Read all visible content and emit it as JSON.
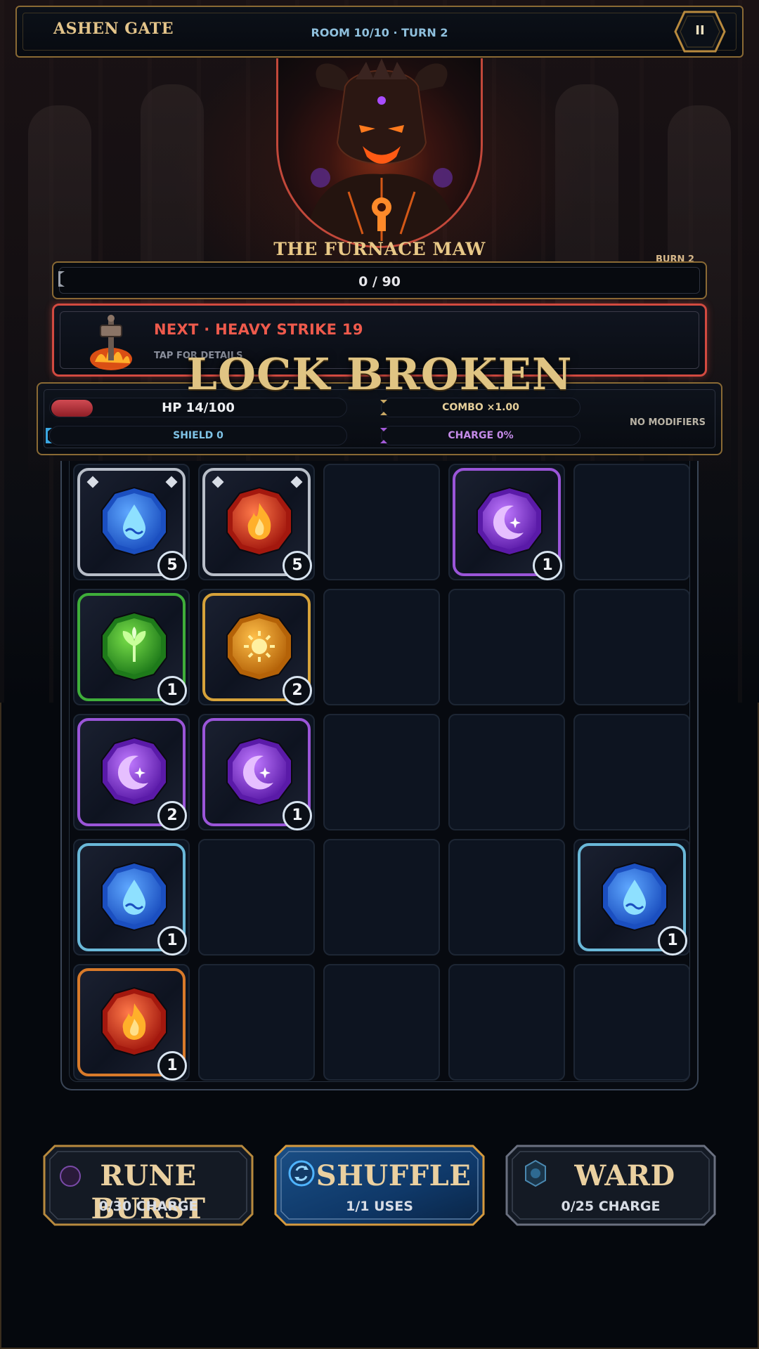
{
  "header": {
    "title": "ASHEN GATE",
    "room_info": "ROOM 10/10 · TURN 2",
    "pause_label": "II"
  },
  "boss": {
    "name": "THE FURNACE MAW",
    "burn_tag": "BURN 2",
    "hp_text": "0 / 90",
    "hp_fraction": 0.0
  },
  "intent": {
    "title": "NEXT · HEAVY STRIKE 19",
    "subtitle": "TAP FOR DETAILS",
    "icon": "flaming-hammer-icon"
  },
  "banner": {
    "text": "LOCK BROKEN"
  },
  "player": {
    "hp_text": "HP 14/100",
    "hp_fraction": 0.14,
    "shield_text": "SHIELD 0",
    "combo_text": "COMBO ×1.00",
    "charge_text": "CHARGE 0%",
    "modifiers_text": "NO MODIFIERS"
  },
  "colors": {
    "water": "#2f6fe0",
    "fire": "#d8402a",
    "moon": "#9a4fe0",
    "leaf": "#3fae3a",
    "sun": "#e69a22",
    "gold_border": "#8a6a34",
    "danger": "#d24a40"
  },
  "board": {
    "cells": [
      {
        "row": 0,
        "col": 0,
        "gem": "water",
        "count": "5",
        "frame": "silver"
      },
      {
        "row": 0,
        "col": 1,
        "gem": "fire",
        "count": "5",
        "frame": "silver"
      },
      {
        "row": 0,
        "col": 3,
        "gem": "moon",
        "count": "1",
        "frame": "purple"
      },
      {
        "row": 1,
        "col": 0,
        "gem": "leaf",
        "count": "1",
        "frame": "green"
      },
      {
        "row": 1,
        "col": 1,
        "gem": "sun",
        "count": "2",
        "frame": "gold"
      },
      {
        "row": 2,
        "col": 0,
        "gem": "moon",
        "count": "2",
        "frame": "purple"
      },
      {
        "row": 2,
        "col": 1,
        "gem": "moon",
        "count": "1",
        "frame": "purple"
      },
      {
        "row": 3,
        "col": 0,
        "gem": "water",
        "count": "1",
        "frame": "cyan"
      },
      {
        "row": 3,
        "col": 4,
        "gem": "water",
        "count": "1",
        "frame": "cyan"
      },
      {
        "row": 4,
        "col": 0,
        "gem": "fire",
        "count": "1",
        "frame": "orange"
      }
    ]
  },
  "abilities": [
    {
      "name": "RUNE BURST",
      "sub": "0/30 CHARGE",
      "icon": "rune-burst-icon",
      "active": false
    },
    {
      "name": "SHUFFLE",
      "sub": "1/1 USES",
      "icon": "shuffle-icon",
      "active": true
    },
    {
      "name": "WARD",
      "sub": "0/25 CHARGE",
      "icon": "ward-icon",
      "active": false
    }
  ]
}
